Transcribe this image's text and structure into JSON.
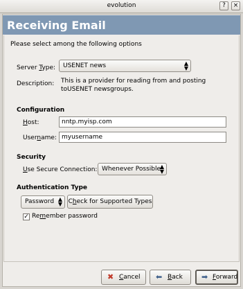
{
  "window": {
    "title": "evolution",
    "close_glyph": "×",
    "help_glyph": "?"
  },
  "banner": {
    "title": "Receiving Email"
  },
  "intro": "Please select among the following options",
  "server": {
    "type_label": "Server Type:",
    "type_value": "USENET news",
    "description_label": "Description:",
    "description_line1": "This is a provider for reading from and posting",
    "description_line2": "toUSENET newsgroups."
  },
  "configuration": {
    "heading": "Configuration",
    "host_label": "Host:",
    "host_value": "nntp.myisp.com",
    "username_label": "Username:",
    "username_value": "myusername"
  },
  "security": {
    "heading": "Security",
    "secure_label": "Use Secure Connection:",
    "secure_value": "Whenever Possible"
  },
  "auth": {
    "heading": "Authentication Type",
    "type_value": "Password",
    "check_label": "Check for Supported Types",
    "remember_label": "Remember password",
    "remember_checked": true
  },
  "footer": {
    "cancel_label": "Cancel",
    "back_label": "Back",
    "forward_label": "Forward",
    "cancel_icon": "cancel-icon",
    "back_icon": "back-arrow-icon",
    "forward_icon": "forward-arrow-icon"
  }
}
